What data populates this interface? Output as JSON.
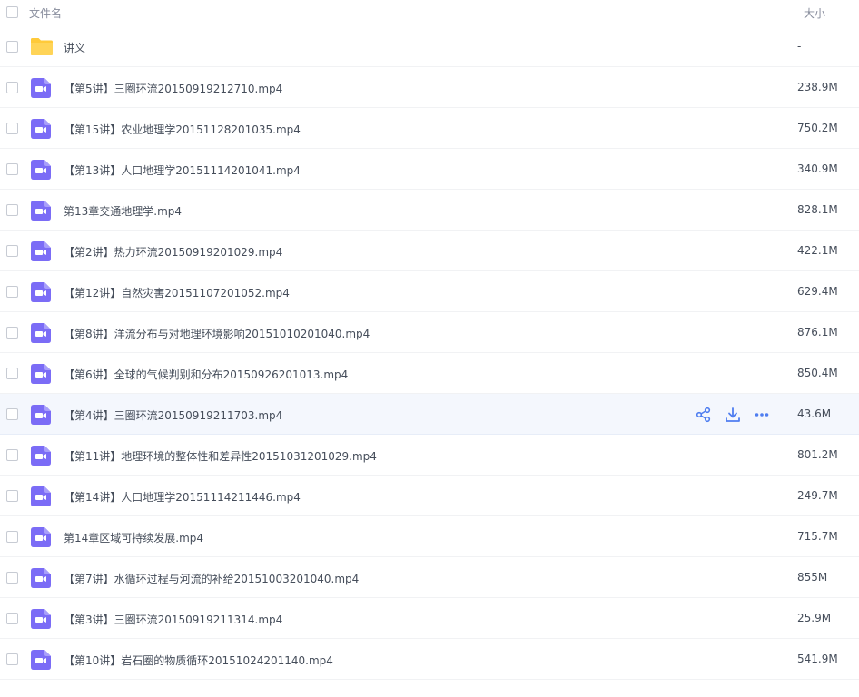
{
  "header": {
    "name_label": "文件名",
    "size_label": "大小"
  },
  "colors": {
    "accent": "#4f7ef0",
    "video_icon": "#7b6cf6",
    "folder": "#ffca3a"
  },
  "rows": [
    {
      "name": "讲义",
      "size": "-",
      "type": "folder"
    },
    {
      "name": "【第5讲】三圈环流20150919212710.mp4",
      "size": "238.9M",
      "type": "video"
    },
    {
      "name": "【第15讲】农业地理学20151128201035.mp4",
      "size": "750.2M",
      "type": "video"
    },
    {
      "name": "【第13讲】人口地理学20151114201041.mp4",
      "size": "340.9M",
      "type": "video"
    },
    {
      "name": "第13章交通地理学.mp4",
      "size": "828.1M",
      "type": "video"
    },
    {
      "name": "【第2讲】热力环流20150919201029.mp4",
      "size": "422.1M",
      "type": "video"
    },
    {
      "name": "【第12讲】自然灾害20151107201052.mp4",
      "size": "629.4M",
      "type": "video"
    },
    {
      "name": "【第8讲】洋流分布与对地理环境影响20151010201040.mp4",
      "size": "876.1M",
      "type": "video"
    },
    {
      "name": "【第6讲】全球的气候判别和分布20150926201013.mp4",
      "size": "850.4M",
      "type": "video"
    },
    {
      "name": "【第4讲】三圈环流20150919211703.mp4",
      "size": "43.6M",
      "type": "video",
      "hovered": true
    },
    {
      "name": "【第11讲】地理环境的整体性和差异性20151031201029.mp4",
      "size": "801.2M",
      "type": "video"
    },
    {
      "name": "【第14讲】人口地理学20151114211446.mp4",
      "size": "249.7M",
      "type": "video"
    },
    {
      "name": "第14章区域可持续发展.mp4",
      "size": "715.7M",
      "type": "video"
    },
    {
      "name": "【第7讲】水循环过程与河流的补给20151003201040.mp4",
      "size": "855M",
      "type": "video"
    },
    {
      "name": "【第3讲】三圈环流20150919211314.mp4",
      "size": "25.9M",
      "type": "video"
    },
    {
      "name": "【第10讲】岩石圈的物质循环20151024201140.mp4",
      "size": "541.9M",
      "type": "video"
    }
  ],
  "row_actions": [
    {
      "icon": "share-icon"
    },
    {
      "icon": "download-icon"
    },
    {
      "icon": "more-icon"
    }
  ]
}
